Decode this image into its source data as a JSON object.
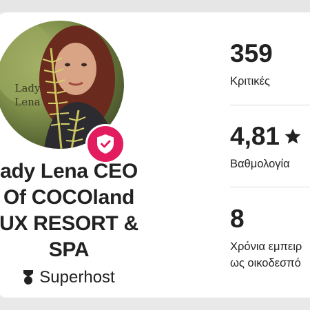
{
  "profile": {
    "name": "ady Lena CEO\nOf COCOland\nUX RESORT &\nSPA",
    "avatar_overlay_text": "Lady\nLena",
    "superhost_label": "Superhost"
  },
  "stats": [
    {
      "value": "359",
      "label": "Κριτικές"
    },
    {
      "value": "4,81",
      "label": "Βαθμολογία"
    },
    {
      "value": "8",
      "label": "Χρόνια εμπειρ\nως οικοδεσπό"
    }
  ],
  "icons": {
    "verify": "shield-check-icon",
    "rating": "star-icon",
    "superhost": "superhost-medal-icon"
  },
  "colors": {
    "accent": "#e31c5f",
    "text": "#222222",
    "divider": "#dddddd"
  }
}
